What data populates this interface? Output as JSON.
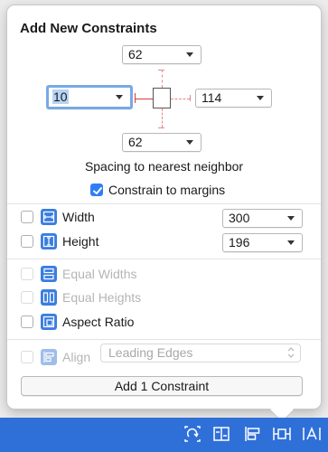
{
  "panel": {
    "title": "Add New Constraints",
    "spacing_caption": "Spacing to nearest neighbor",
    "constrain_to_margins": {
      "label": "Constrain to margins",
      "checked": true
    }
  },
  "spacing": {
    "top": "62",
    "left": "10",
    "right": "114",
    "bottom": "62"
  },
  "size": {
    "width": {
      "label": "Width",
      "value": "300",
      "checked": false
    },
    "height": {
      "label": "Height",
      "value": "196",
      "checked": false
    }
  },
  "equal": {
    "widths": {
      "label": "Equal Widths",
      "enabled": false
    },
    "heights": {
      "label": "Equal Heights",
      "enabled": false
    },
    "aspect": {
      "label": "Aspect Ratio",
      "enabled": true
    }
  },
  "align": {
    "label": "Align",
    "value": "Leading Edges",
    "enabled": false
  },
  "add_button": {
    "label": "Add 1 Constraint"
  },
  "bottom_bar": {
    "icons": [
      "update-frames-icon",
      "embed-in-stack-icon",
      "align-icon",
      "add-constraints-icon",
      "resolve-issues-icon"
    ]
  },
  "colors": {
    "accent": "#2f7ef6",
    "constraint_red": "#d73a3a",
    "bar_blue": "#2f6fd8"
  }
}
